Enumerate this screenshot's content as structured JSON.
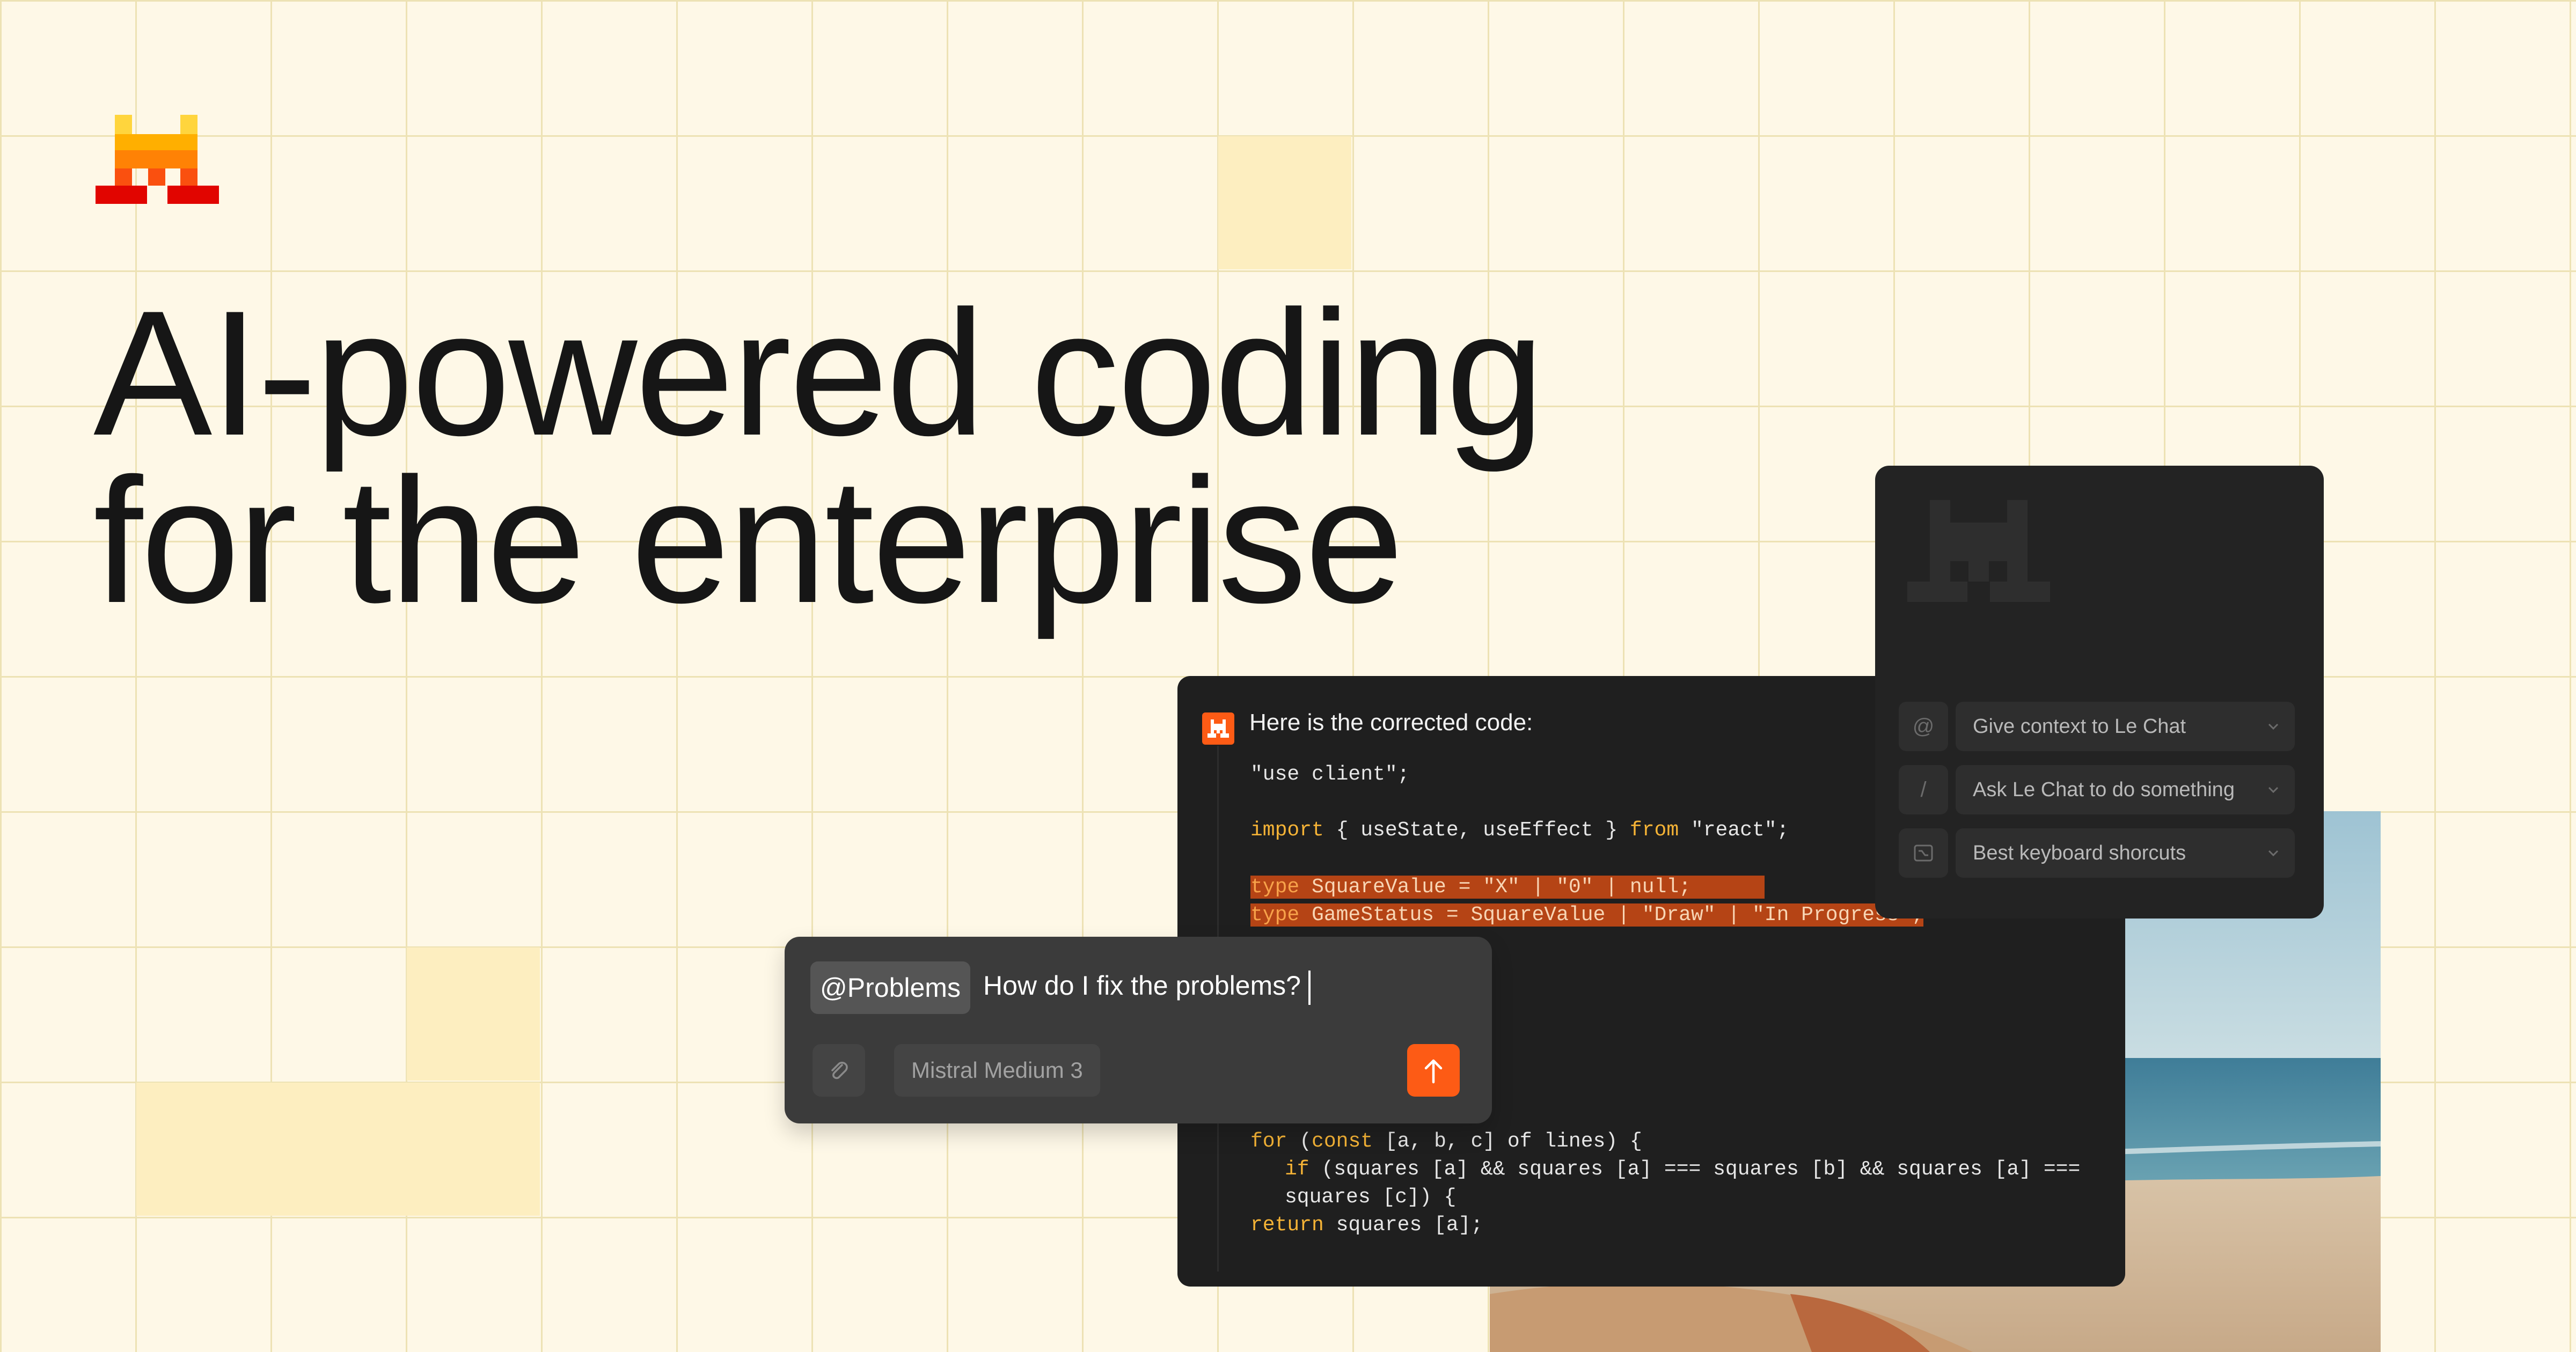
{
  "brand": {
    "logo_icon": "mistral-pixel-logo-icon",
    "colors": [
      "#ffd53d",
      "#ffaf00",
      "#ff8205",
      "#fa500f",
      "#e10500"
    ]
  },
  "headline": {
    "line1": "AI-powered coding",
    "line2": "for the enterprise"
  },
  "code_panel": {
    "intro": "Here is the corrected code:",
    "lines": {
      "use_client": "\"use client\";",
      "import_kw": "import",
      "import_body": " { useState, useEffect } ",
      "from_kw": "from",
      "import_src": " \"react\";",
      "type_kw": "type",
      "square_type": " SquareValue = \"X\" | \"0\" | null;",
      "status_type": " GameStatus = SquareValue | \"Draw\" | \"In Progress\";",
      "for_kw": "for",
      "const_kw": "const",
      "for_body": " [a, b, c] of lines) {",
      "if_kw": "if",
      "if_body": " (squares [a] && squares [a] === squares [b] && squares [a] ===",
      "if_cont": "squares [c]) {",
      "return_kw": "return",
      "return_body": " squares [a];"
    }
  },
  "command_panel": {
    "items": [
      {
        "key": "@",
        "label": "Give context to Le Chat"
      },
      {
        "key": "/",
        "label": "Ask Le Chat to do something"
      },
      {
        "key": "keyboard-icon",
        "label": "Best keyboard shorcuts"
      }
    ]
  },
  "chat_box": {
    "mention": "@Problems",
    "question": "How do I fix the problems?",
    "model": "Mistral Medium 3",
    "accent": "#fd5b15"
  }
}
